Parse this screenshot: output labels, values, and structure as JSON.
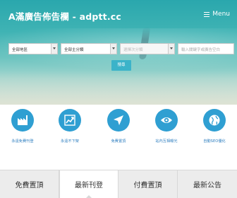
{
  "header": {
    "brand": "A滿廣告佈告欄 - adptt.cc",
    "menu_label": "Menu"
  },
  "filters": {
    "region_select": "全部地區",
    "category_select": "全部主分類",
    "subcategory_select": "選擇次分類",
    "keyword_placeholder": "輸入關鍵字或廣告空白",
    "search_button": "搜尋"
  },
  "features": [
    {
      "label": "永遠免費刊登",
      "icon": "factory-icon"
    },
    {
      "label": "永遠不下架",
      "icon": "trend-up-icon"
    },
    {
      "label": "免費置頂",
      "icon": "send-arrow-icon"
    },
    {
      "label": "站內互相曝光",
      "icon": "eye-icon"
    },
    {
      "label": "自動SEO優化",
      "icon": "globe-icon"
    }
  ],
  "tabs": [
    {
      "label": "免費置頂"
    },
    {
      "label": "最新刊登"
    },
    {
      "label": "付費置頂"
    },
    {
      "label": "最新公告"
    }
  ],
  "colors": {
    "accent": "#2f9fd2",
    "hero": "#3fb3b4",
    "button": "#3bb3c9"
  }
}
